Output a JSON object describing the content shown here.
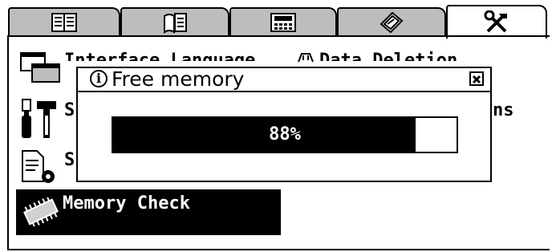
{
  "tabs": [
    {
      "icon": "book-icon",
      "active": false
    },
    {
      "icon": "notebook-icon",
      "active": false
    },
    {
      "icon": "calculator-icon",
      "active": false
    },
    {
      "icon": "cards-icon",
      "active": false
    },
    {
      "icon": "tools-icon",
      "active": true
    }
  ],
  "menu": {
    "interface_language": "Interface Language",
    "data_deletion": "Data Deletion",
    "item2_label": "S",
    "item2_right_label": "ns",
    "item3_label": "S",
    "memory_check": "Memory Check"
  },
  "dialog": {
    "title": "Free memory",
    "progress_percent": 88,
    "progress_text": "88%"
  },
  "colors": {
    "tab_inactive": "#bdbdbd",
    "foreground": "#000000",
    "background": "#ffffff"
  }
}
